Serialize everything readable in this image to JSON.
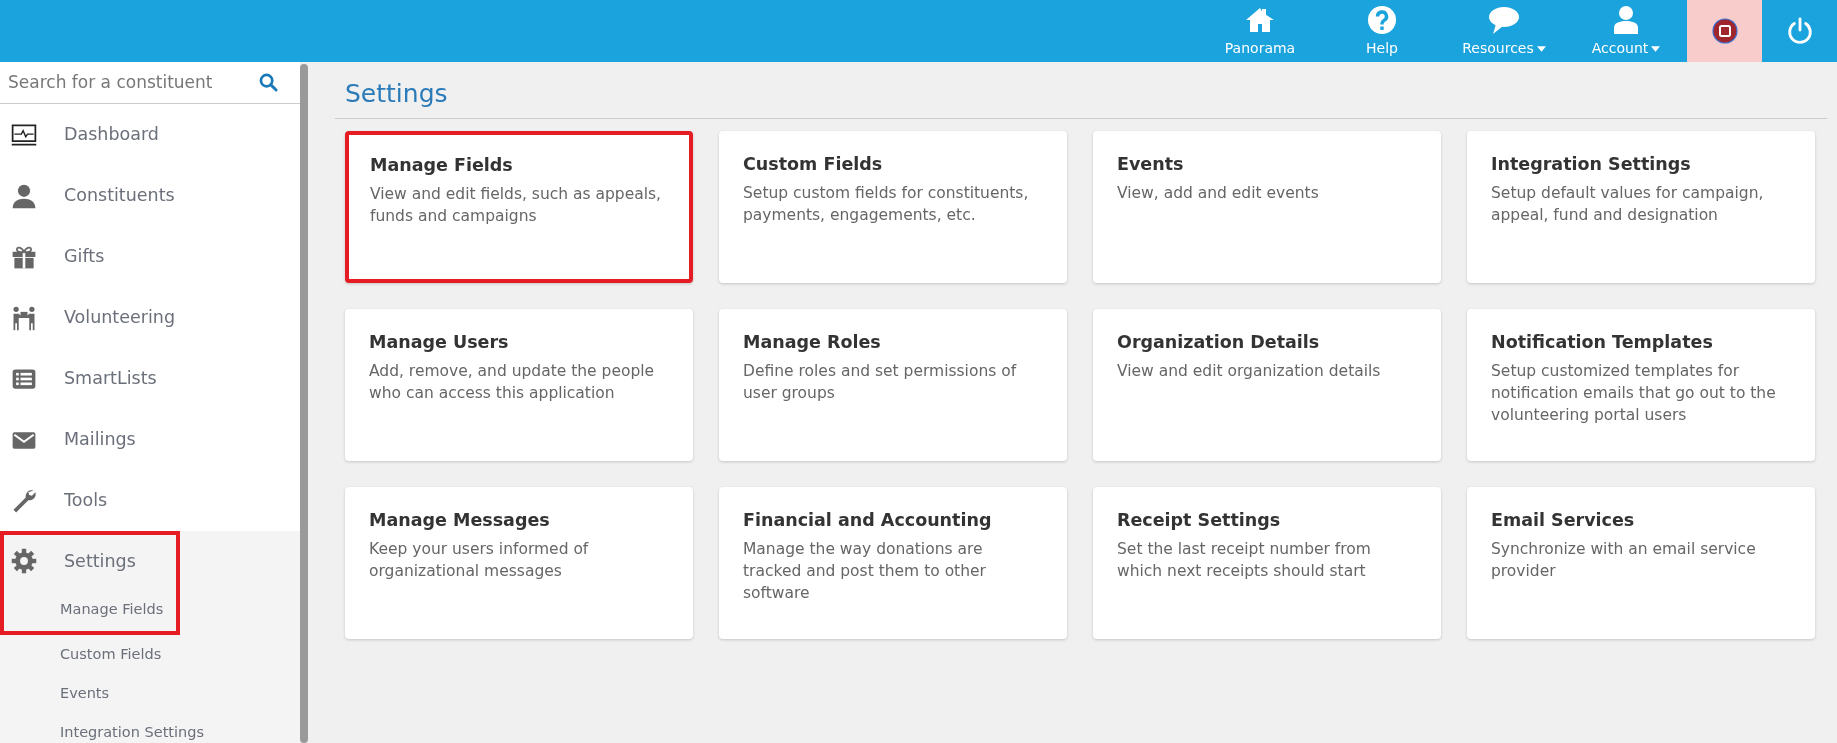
{
  "topbar": {
    "items": [
      {
        "label": "Panorama",
        "dropdown": false
      },
      {
        "label": "Help",
        "dropdown": false
      },
      {
        "label": "Resources",
        "dropdown": true
      },
      {
        "label": "Account",
        "dropdown": true
      }
    ],
    "stop_button": {
      "active": true
    }
  },
  "sidebar": {
    "search": {
      "placeholder": "Search for a constituent"
    },
    "items": [
      {
        "label": "Dashboard",
        "highlighted": false
      },
      {
        "label": "Constituents",
        "highlighted": false
      },
      {
        "label": "Gifts",
        "highlighted": false
      },
      {
        "label": "Volunteering",
        "highlighted": false
      },
      {
        "label": "SmartLists",
        "highlighted": false
      },
      {
        "label": "Mailings",
        "highlighted": false
      },
      {
        "label": "Tools",
        "highlighted": false
      },
      {
        "label": "Settings",
        "highlighted": true,
        "children": [
          {
            "label": "Manage Fields",
            "highlighted": true
          },
          {
            "label": "Custom Fields",
            "highlighted": false
          },
          {
            "label": "Events",
            "highlighted": false
          },
          {
            "label": "Integration Settings",
            "highlighted": false
          }
        ]
      }
    ]
  },
  "page": {
    "title": "Settings",
    "cards": [
      {
        "title": "Manage Fields",
        "description": "View and edit fields, such as appeals, funds and campaigns",
        "highlighted": true
      },
      {
        "title": "Custom Fields",
        "description": "Setup custom fields for constituents, payments, engagements, etc.",
        "highlighted": false
      },
      {
        "title": "Events",
        "description": "View, add and edit events",
        "highlighted": false
      },
      {
        "title": "Integration Settings",
        "description": "Setup default values for campaign, appeal, fund and designation",
        "highlighted": false
      },
      {
        "title": "Manage Users",
        "description": "Add, remove, and update the people who can access this application",
        "highlighted": false
      },
      {
        "title": "Manage Roles",
        "description": "Define roles and set permissions of user groups",
        "highlighted": false
      },
      {
        "title": "Organization Details",
        "description": "View and edit organization details",
        "highlighted": false
      },
      {
        "title": "Notification Templates",
        "description": "Setup customized templates for notification emails that go out to the volunteering portal users",
        "highlighted": false
      },
      {
        "title": "Manage Messages",
        "description": "Keep your users informed of organizational messages",
        "highlighted": false
      },
      {
        "title": "Financial and Accounting",
        "description": "Manage the way donations are tracked and post them to other software",
        "highlighted": false
      },
      {
        "title": "Receipt Settings",
        "description": "Set the last receipt number from which next receipts should start",
        "highlighted": false
      },
      {
        "title": "Email Services",
        "description": "Synchronize with an email service provider",
        "highlighted": false
      }
    ]
  }
}
